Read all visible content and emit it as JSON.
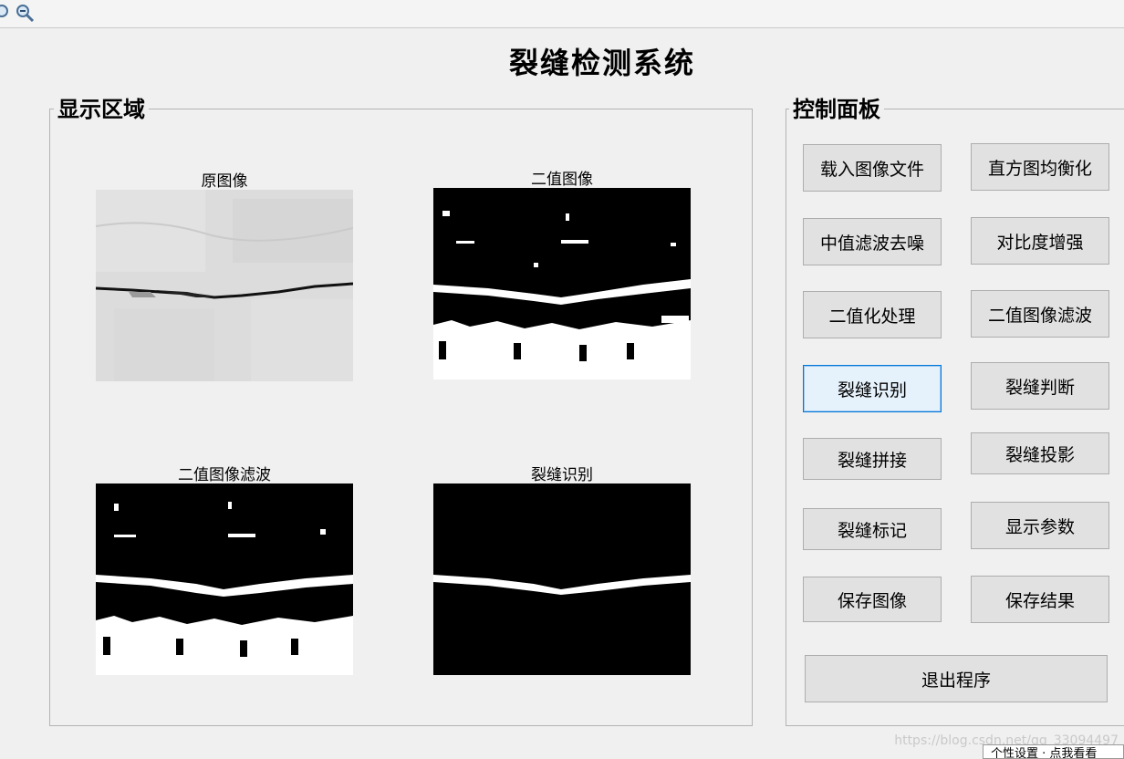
{
  "toolbar": {
    "icons": [
      "zoom-in-icon",
      "zoom-out-icon"
    ]
  },
  "app": {
    "title": "裂缝检测系统"
  },
  "display_panel": {
    "title": "显示区域",
    "captions": {
      "original": "原图像",
      "binary": "二值图像",
      "binary_filtered": "二值图像滤波",
      "crack_recognition": "裂缝识别"
    }
  },
  "control_panel": {
    "title": "控制面板",
    "buttons": {
      "load_image": "载入图像文件",
      "histogram_eq": "直方图均衡化",
      "median_filter": "中值滤波去噪",
      "contrast_enhance": "对比度增强",
      "binarize": "二值化处理",
      "binary_filter": "二值图像滤波",
      "crack_recognition": "裂缝识别",
      "crack_judge": "裂缝判断",
      "crack_stitch": "裂缝拼接",
      "crack_projection": "裂缝投影",
      "crack_mark": "裂缝标记",
      "show_params": "显示参数",
      "save_image": "保存图像",
      "save_result": "保存结果",
      "exit": "退出程序"
    },
    "active_button": "crack_recognition"
  },
  "watermark": "https://blog.csdn.net/qq_33094497",
  "tooltip": "个性设置 · 点我看看",
  "colors": {
    "background": "#f0f0f0",
    "button_face": "#e1e1e1",
    "button_active_face": "#e5f1fb",
    "button_active_border": "#0078d7"
  }
}
